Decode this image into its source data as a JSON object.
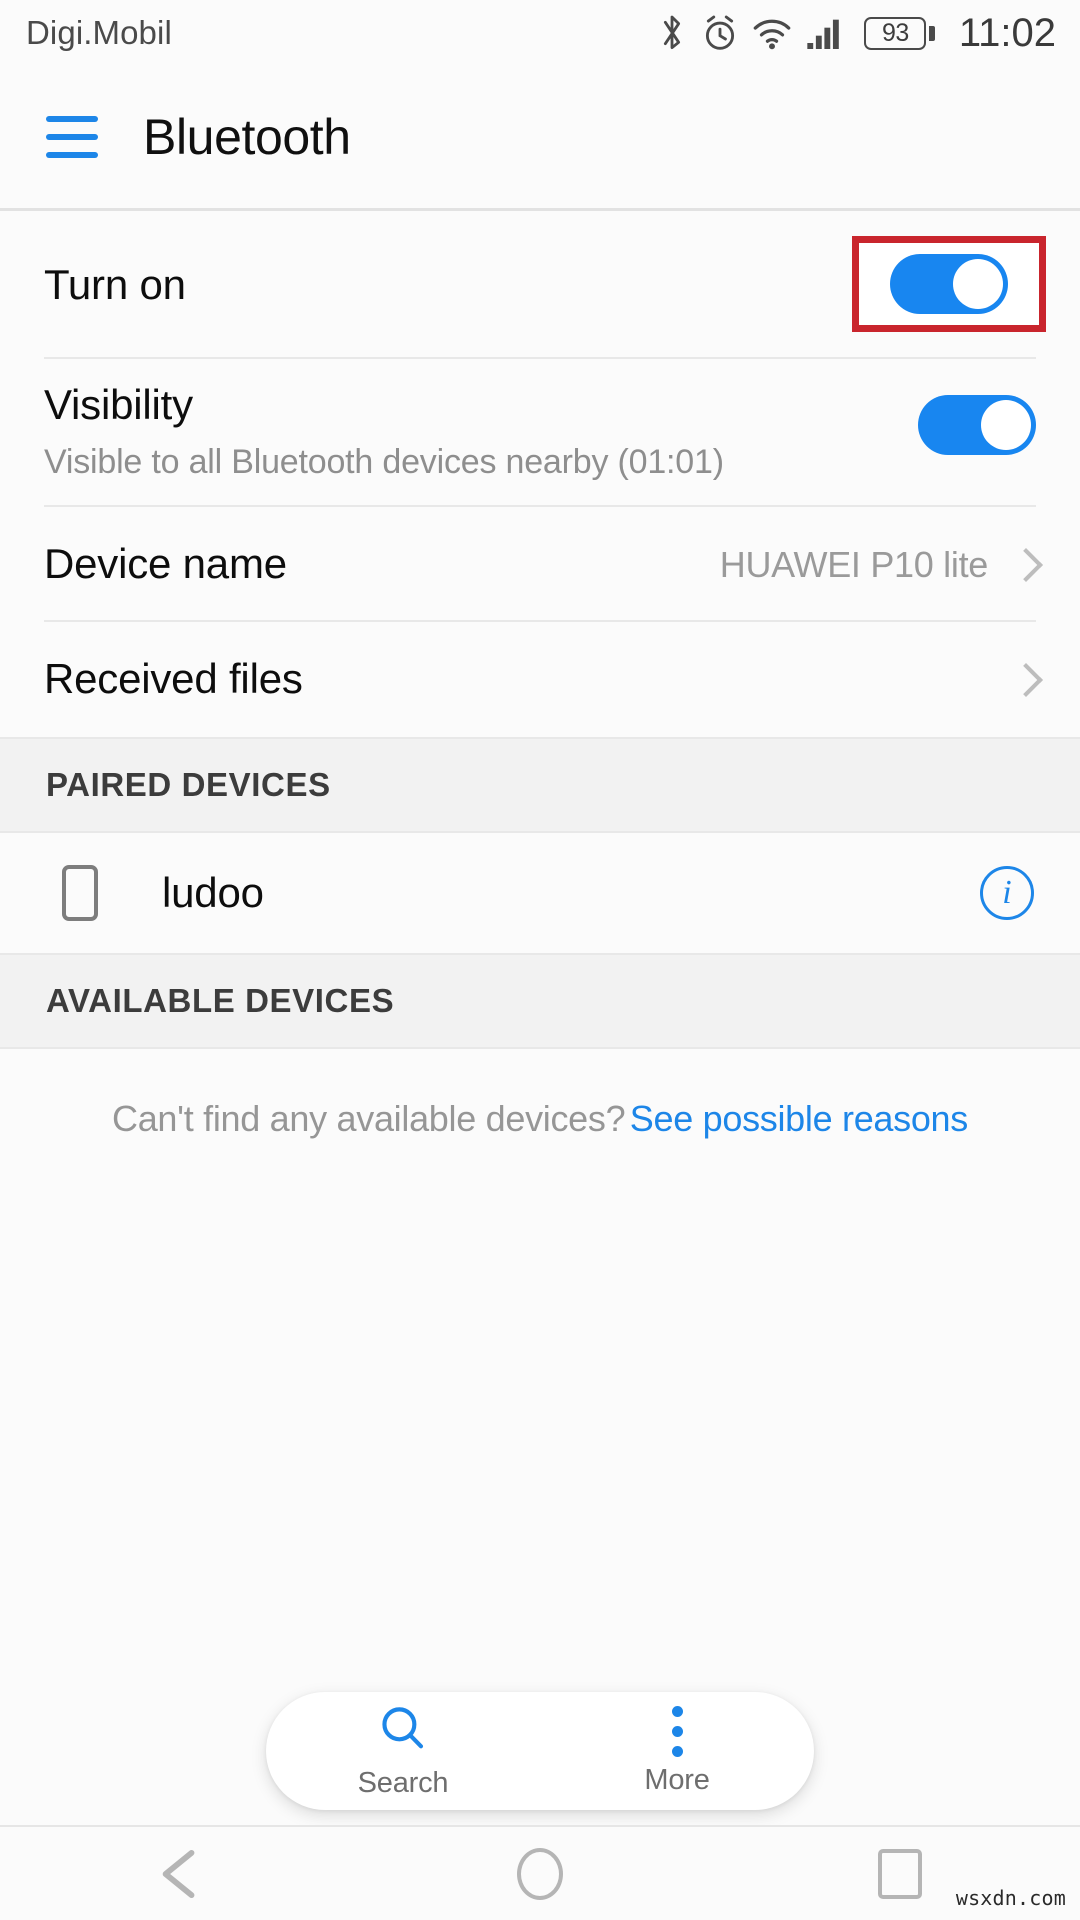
{
  "status_bar": {
    "carrier": "Digi.Mobil",
    "icons": [
      "bluetooth-icon",
      "alarm-icon",
      "wifi-icon",
      "signal-icon"
    ],
    "battery_level": "93",
    "clock": "11:02"
  },
  "header": {
    "menu_icon": "hamburger-menu-icon",
    "title": "Bluetooth",
    "accent_color": "#1d86e8"
  },
  "settings": {
    "turn_on": {
      "label": "Turn on",
      "toggle_state": "on",
      "highlighted": true,
      "highlight_color": "#c9252d"
    },
    "visibility": {
      "label": "Visibility",
      "subtitle": "Visible to all Bluetooth devices nearby (01:01)",
      "toggle_state": "on"
    },
    "device_name": {
      "label": "Device name",
      "value": "HUAWEI P10 lite",
      "chevron": "chevron-right-icon"
    },
    "received_files": {
      "label": "Received files",
      "chevron": "chevron-right-icon"
    }
  },
  "paired_section": {
    "header": "PAIRED DEVICES",
    "devices": [
      {
        "icon": "phone-device-icon",
        "name": "ludoo",
        "action_icon": "info-icon"
      }
    ]
  },
  "available_section": {
    "header": "AVAILABLE DEVICES",
    "empty_hint": "Can't find any available devices?",
    "empty_link": "See possible reasons"
  },
  "action_bar": {
    "items": [
      {
        "icon": "search-icon",
        "label": "Search"
      },
      {
        "icon": "more-vertical-icon",
        "label": "More"
      }
    ]
  },
  "nav_bar": {
    "back": "back-triangle-icon",
    "home": "home-circle-icon",
    "recents": "recents-square-icon"
  },
  "watermark": "wsxdn.com"
}
